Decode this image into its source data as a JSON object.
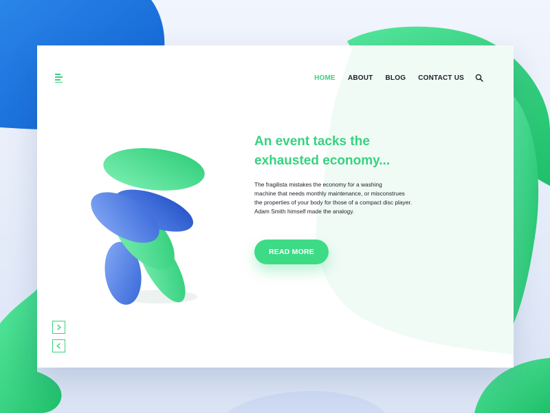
{
  "colors": {
    "accent": "#36d27f",
    "blue": "#1e6fd6",
    "text": "#1c1f26"
  },
  "header": {
    "menu_icon": "hamburger-menu-icon",
    "nav": [
      {
        "label": "HOME",
        "active": true
      },
      {
        "label": "ABOUT",
        "active": false
      },
      {
        "label": "BLOG",
        "active": false
      },
      {
        "label": "CONTACT US",
        "active": false
      }
    ],
    "search_icon": "search-icon"
  },
  "hero": {
    "title_line1": "An event tacks the",
    "title_line2": "exhausted economy...",
    "body_lines": [
      "The fragilista mistakes the economy for a washing",
      "machine that needs monthly maintenance, or misconstrues",
      "the properties of your body for those of a compact disc player.",
      "Adam Smith himself made the analogy."
    ],
    "cta_label": "READ MORE"
  },
  "slider": {
    "next_icon": "chevron-right-icon",
    "prev_icon": "chevron-left-icon"
  }
}
